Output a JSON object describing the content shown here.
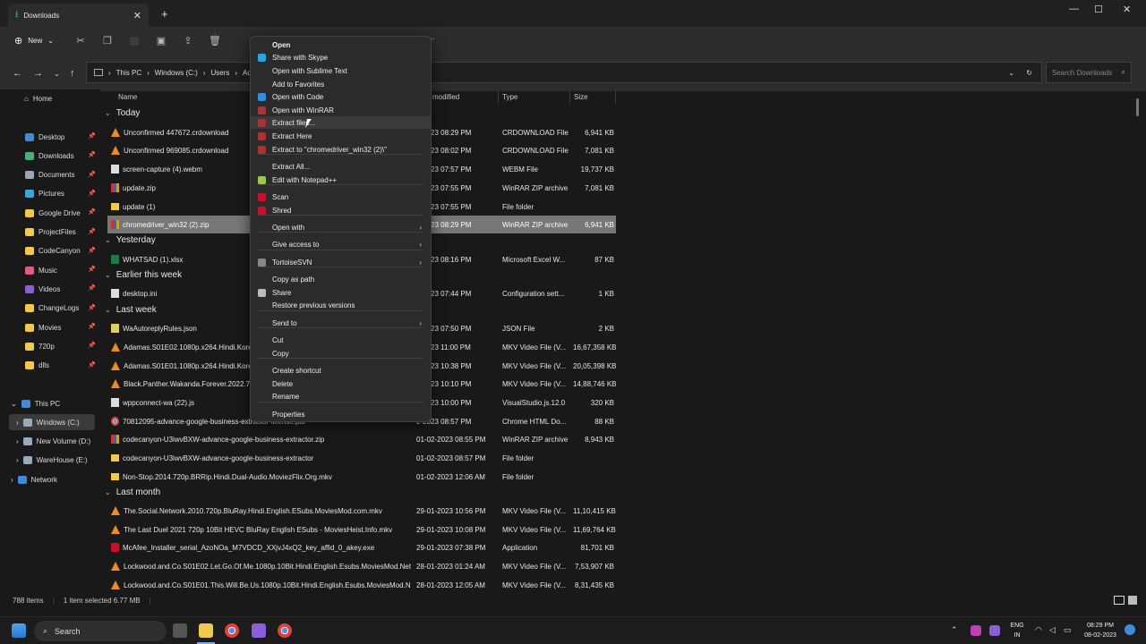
{
  "window": {
    "tab_title": "Downloads",
    "new_tab": "+",
    "min": "—",
    "max": "☐",
    "close": "✕"
  },
  "toolbar": {
    "new_label": "New",
    "more": "···"
  },
  "address": {
    "crumbs": [
      "This PC",
      "Windows (C:)",
      "Users",
      "Adm"
    ],
    "search_placeholder": "Search Downloads"
  },
  "sidebar": {
    "home": "Home",
    "quick": [
      {
        "label": "Desktop",
        "color": "#3d8bd9"
      },
      {
        "label": "Downloads",
        "color": "#4caf7a"
      },
      {
        "label": "Documents",
        "color": "#9aa7b5"
      },
      {
        "label": "Pictures",
        "color": "#3da5d9"
      },
      {
        "label": "Google Drive",
        "color": "#f2c94c"
      },
      {
        "label": "ProjectFiles",
        "color": "#f2c94c"
      },
      {
        "label": "CodeCanyon",
        "color": "#f2c94c"
      },
      {
        "label": "Music",
        "color": "#e25b7a"
      },
      {
        "label": "Videos",
        "color": "#8a5fd9"
      },
      {
        "label": "ChangeLogs",
        "color": "#f2c94c"
      },
      {
        "label": "Movies",
        "color": "#f2c94c"
      },
      {
        "label": "720p",
        "color": "#f2c94c"
      },
      {
        "label": "dlls",
        "color": "#f2c94c"
      }
    ],
    "this_pc": "This PC",
    "drives": [
      "Windows (C:)",
      "New Volume (D:)",
      "WareHouse (E:)"
    ],
    "network": "Network"
  },
  "columns": {
    "name": "Name",
    "modified": "modified",
    "type": "Type",
    "size": "Size"
  },
  "groups": {
    "today": "Today",
    "yesterday": "Yesterday",
    "earlier": "Earlier this week",
    "last_week": "Last week",
    "last_month": "Last month"
  },
  "files": [
    {
      "name": "Unconfirmed 447672.crdownload",
      "date": "2-2023 08:29 PM",
      "type": "CRDOWNLOAD File",
      "size": "6,941 KB",
      "icon": "vlc"
    },
    {
      "name": "Unconfirmed 969085.crdownload",
      "date": "2-2023 08:02 PM",
      "type": "CRDOWNLOAD File",
      "size": "7,081 KB",
      "icon": "vlc"
    },
    {
      "name": "screen-capture (4).webm",
      "date": "2-2023 07:57 PM",
      "type": "WEBM File",
      "size": "19,737 KB",
      "icon": "doc"
    },
    {
      "name": "update.zip",
      "date": "2-2023 07:55 PM",
      "type": "WinRAR ZIP archive",
      "size": "7,081 KB",
      "icon": "zip"
    },
    {
      "name": "update (1)",
      "date": "2-2023 07:55 PM",
      "type": "File folder",
      "size": "",
      "icon": "folder"
    },
    {
      "name": "chromedriver_win32 (2).zip",
      "date": "2-2023 08:29 PM",
      "type": "WinRAR ZIP archive",
      "size": "6,941 KB",
      "icon": "zip"
    },
    {
      "name": "WHATSAD (1).xlsx",
      "date": "2-2023 08:16 PM",
      "type": "Microsoft Excel W...",
      "size": "87 KB",
      "icon": "xls"
    },
    {
      "name": "desktop.ini",
      "date": "2-2023 07:44 PM",
      "type": "Configuration sett...",
      "size": "1 KB",
      "icon": "doc"
    },
    {
      "name": "WaAutoreplyRules.json",
      "date": "2-2023 07:50 PM",
      "type": "JSON File",
      "size": "2 KB",
      "icon": "json"
    },
    {
      "name": "Adamas.S01E02.1080p.x264.Hindi.Korean",
      "date": "2-2023 11:00 PM",
      "type": "MKV Video File (V...",
      "size": "16,67,358 KB",
      "icon": "vlc"
    },
    {
      "name": "Adamas.S01E01.1080p.x264.Hindi.Korean",
      "date": "2-2023 10:38 PM",
      "type": "MKV Video File (V...",
      "size": "20,05,398 KB",
      "icon": "vlc"
    },
    {
      "name": "Black.Panther.Wakanda.Forever.2022.720",
      "date": "2-2023 10:10 PM",
      "type": "MKV Video File (V...",
      "size": "14,88,746 KB",
      "icon": "vlc"
    },
    {
      "name": "wppconnect-wa (22).js",
      "date": "2-2023 10:00 PM",
      "type": "VisualStudio.js.12.0",
      "size": "320 KB",
      "icon": "doc"
    },
    {
      "name": "70812095-advance-google-business-extractor-license.pdf",
      "date": "2-2023 08:57 PM",
      "type": "Chrome HTML Do...",
      "size": "88 KB",
      "icon": "chrome"
    },
    {
      "name": "codecanyon-U3iwvBXW-advance-google-business-extractor.zip",
      "date": "01-02-2023 08:55 PM",
      "type": "WinRAR ZIP archive",
      "size": "8,943 KB",
      "icon": "zip"
    },
    {
      "name": "codecanyon-U3iwvBXW-advance-google-business-extractor",
      "date": "01-02-2023 08:57 PM",
      "type": "File folder",
      "size": "",
      "icon": "folder"
    },
    {
      "name": "Non-Stop.2014.720p.BRRip.Hindi.Dual-Audio.MoviezFlix.Org.mkv",
      "date": "01-02-2023 12:06 AM",
      "type": "File folder",
      "size": "",
      "icon": "folder"
    },
    {
      "name": "The.Social.Network.2010.720p.BluRay.Hindi.English.ESubs.MoviesMod.com.mkv",
      "date": "29-01-2023 10:56 PM",
      "type": "MKV Video File (V...",
      "size": "11,10,415 KB",
      "icon": "vlc"
    },
    {
      "name": "The Last Duel 2021 720p 10Bit HEVC BluRay English ESubs - MoviesHeist.Info.mkv",
      "date": "29-01-2023 10:08 PM",
      "type": "MKV Video File (V...",
      "size": "11,69,764 KB",
      "icon": "vlc"
    },
    {
      "name": "McAfee_Installer_serial_AzoNOa_M7VDCD_XXjvJ4xQ2_key_affid_0_akey.exe",
      "date": "29-01-2023 07:38 PM",
      "type": "Application",
      "size": "81,701 KB",
      "icon": "mca"
    },
    {
      "name": "Lockwood.and.Co.S01E02.Let.Go.Of.Me.1080p.10Bit.Hindi.English.Esubs.MoviesMod.Net....",
      "date": "28-01-2023 01:24 AM",
      "type": "MKV Video File (V...",
      "size": "7,53,907 KB",
      "icon": "vlc"
    },
    {
      "name": "Lockwood.and.Co.S01E01.This.Will.Be.Us.1080p.10Bit.Hindi.English.Esubs.MoviesMod.Net....",
      "date": "28-01-2023 12:05 AM",
      "type": "MKV Video File (V...",
      "size": "8,31,435 KB",
      "icon": "vlc"
    }
  ],
  "context_menu": [
    {
      "label": "Open",
      "icon": "",
      "bold": true
    },
    {
      "label": "Share with Skype",
      "icon": "#2aa5e0"
    },
    {
      "label": "Open with Sublime Text",
      "icon": ""
    },
    {
      "label": "Add to Favorites",
      "icon": ""
    },
    {
      "label": "Open with Code",
      "icon": "#2f8ee0"
    },
    {
      "label": "Open with WinRAR",
      "icon": "#a33"
    },
    {
      "label": "Extract files...",
      "icon": "#a33"
    },
    {
      "label": "Extract Here",
      "icon": "#a33"
    },
    {
      "label": "Extract to \"chromedriver_win32 (2)\\\"",
      "icon": "#a33"
    },
    {
      "label": "Extract All...",
      "icon": ""
    },
    {
      "label": "Edit with Notepad++",
      "icon": "#9bc94a"
    },
    {
      "label": "Scan",
      "icon": "#c8102e"
    },
    {
      "label": "Shred",
      "icon": "#c8102e"
    },
    {
      "label": "Open with",
      "icon": "",
      "sub": true
    },
    {
      "label": "Give access to",
      "icon": "",
      "sub": true
    },
    {
      "label": "TortoiseSVN",
      "icon": "#888",
      "sub": true
    },
    {
      "label": "Copy as path",
      "icon": ""
    },
    {
      "label": "Share",
      "icon": "#bbb"
    },
    {
      "label": "Restore previous versions",
      "icon": ""
    },
    {
      "label": "Send to",
      "icon": "",
      "sub": true
    },
    {
      "label": "Cut",
      "icon": ""
    },
    {
      "label": "Copy",
      "icon": ""
    },
    {
      "label": "Create shortcut",
      "icon": ""
    },
    {
      "label": "Delete",
      "icon": ""
    },
    {
      "label": "Rename",
      "icon": ""
    },
    {
      "label": "Properties",
      "icon": ""
    }
  ],
  "status": {
    "items": "788 items",
    "selected": "1 item selected  6.77 MB"
  },
  "taskbar": {
    "search": "Search",
    "lang1": "ENG",
    "lang2": "IN",
    "time": "08:29 PM",
    "date": "08-02-2023"
  }
}
